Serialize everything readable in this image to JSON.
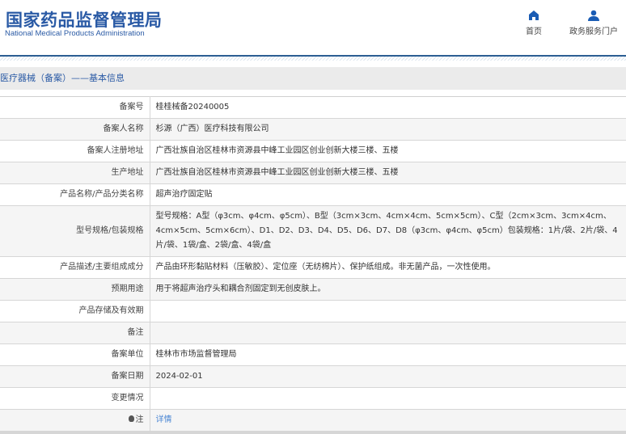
{
  "header": {
    "title_cn": "国家药品监督管理局",
    "title_en": "National Medical Products Administration",
    "nav": [
      {
        "label": "首页",
        "icon": "home-icon"
      },
      {
        "label": "政务服务门户",
        "icon": "user-icon"
      }
    ]
  },
  "section_title": "医疗器械（备案）——基本信息",
  "rows": [
    {
      "label": "备案号",
      "value": "桂桂械备20240005"
    },
    {
      "label": "备案人名称",
      "value": "杉源（广西）医疗科技有限公司"
    },
    {
      "label": "备案人注册地址",
      "value": "广西壮族自治区桂林市资源县中峰工业园区创业创新大楼三楼、五楼"
    },
    {
      "label": "生产地址",
      "value": "广西壮族自治区桂林市资源县中峰工业园区创业创新大楼三楼、五楼"
    },
    {
      "label": "产品名称/产品分类名称",
      "value": "超声治疗固定贴"
    },
    {
      "label": "型号规格/包装规格",
      "value": "型号规格：A型（φ3cm、φ4cm、φ5cm）、B型（3cm×3cm、4cm×4cm、5cm×5cm）、C型（2cm×3cm、3cm×4cm、4cm×5cm、5cm×6cm）、D1、D2、D3、D4、D5、D6、D7、D8（φ3cm、φ4cm、φ5cm）包装规格：1片/袋、2片/袋、4片/袋、1袋/盒、2袋/盒、4袋/盒"
    },
    {
      "label": "产品描述/主要组成成分",
      "value": "产品由环形黏贴材料（压敏胶）、定位座（无纺棉片）、保护纸组成。非无菌产品，一次性使用。"
    },
    {
      "label": "预期用途",
      "value": "用于将超声治疗头和耦合剂固定到无创皮肤上。"
    },
    {
      "label": "产品存储及有效期",
      "value": ""
    },
    {
      "label": "备注",
      "value": ""
    },
    {
      "label": "备案单位",
      "value": "桂林市市场监督管理局"
    },
    {
      "label": "备案日期",
      "value": "2024-02-01"
    },
    {
      "label": "变更情况",
      "value": ""
    }
  ],
  "note": {
    "label": "注",
    "link": "详情"
  }
}
